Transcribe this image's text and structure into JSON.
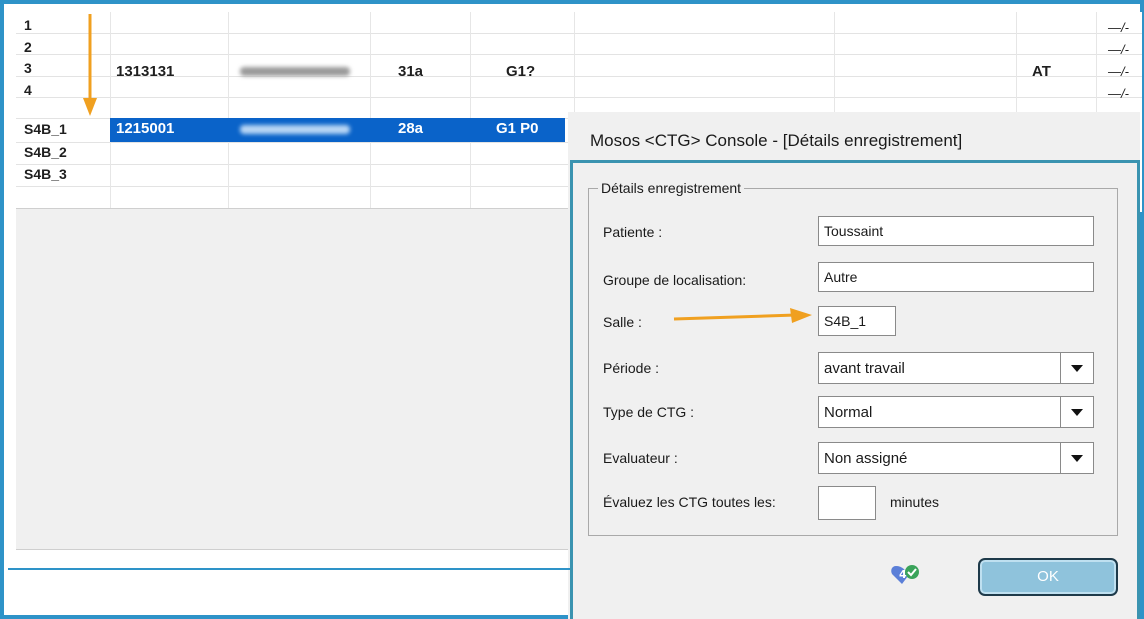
{
  "grid": {
    "rows": [
      {
        "label": "1",
        "cols": {},
        "end": "—/-"
      },
      {
        "label": "2",
        "cols": {},
        "end": "—/-"
      },
      {
        "label": "3",
        "id": "1313131",
        "age": "31a",
        "status": "G1?",
        "code": "AT",
        "end": "—/-"
      },
      {
        "label": "4",
        "cols": {},
        "end": "—/-"
      },
      {
        "label": "S4B_1",
        "id": "1215001",
        "age": "28a",
        "status": "G1 P0"
      },
      {
        "label": "S4B_2"
      },
      {
        "label": "S4B_3"
      }
    ]
  },
  "dialog": {
    "title": "Mosos <CTG> Console - [Détails enregistrement]",
    "group_title": "Détails enregistrement",
    "patient_label": "Patiente :",
    "patient_value": "Toussaint",
    "location_group_label": "Groupe de localisation:",
    "location_group_value": "Autre",
    "room_label": "Salle :",
    "room_value": "S4B_1",
    "period_label": "Période :",
    "period_value": "avant travail",
    "ctg_type_label": "Type de CTG :",
    "ctg_type_value": "Normal",
    "evaluator_label": "Evaluateur :",
    "evaluator_value": "Non assigné",
    "evaluate_label": "Évaluez les CTG toutes les:",
    "evaluate_value": "",
    "minutes_label": "minutes",
    "ok_label": "OK"
  },
  "colors": {
    "accent_border": "#2e93c8",
    "selection": "#0a63c9",
    "arrow": "#f0a020",
    "ok_button": "#8fc3dc"
  },
  "icons": [
    "down-arrow-annotation-icon",
    "right-arrow-annotation-icon",
    "help-heart-icon",
    "dropdown-chevron-icon"
  ]
}
